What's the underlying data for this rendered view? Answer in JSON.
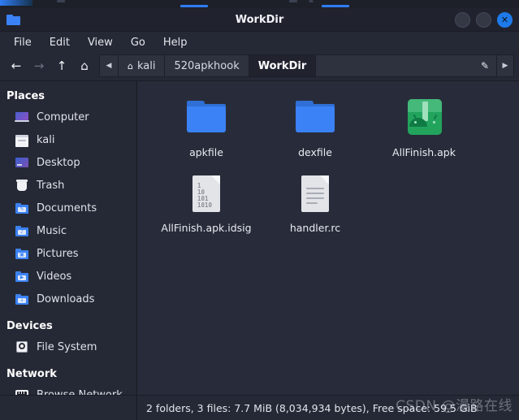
{
  "window": {
    "title": "WorkDir",
    "icon": "folder-icon",
    "buttons": {
      "minimize": "",
      "maximize": "",
      "close": "✕"
    }
  },
  "menubar": {
    "items": [
      {
        "label": "File"
      },
      {
        "label": "Edit"
      },
      {
        "label": "View"
      },
      {
        "label": "Go"
      },
      {
        "label": "Help"
      }
    ]
  },
  "toolbar": {
    "back": "←",
    "forward": "→",
    "up": "↑",
    "home": "⌂",
    "scroll_left": "◀",
    "scroll_right": "▶",
    "edit_path": "✎",
    "breadcrumbs": [
      {
        "label": "kali",
        "icon": "home-icon",
        "active": false
      },
      {
        "label": "520apkhook",
        "icon": "",
        "active": false
      },
      {
        "label": "WorkDir",
        "icon": "",
        "active": true
      }
    ]
  },
  "sidebar": {
    "sections": [
      {
        "title": "Places",
        "items": [
          {
            "label": "Computer",
            "icon": "computer-icon"
          },
          {
            "label": "kali",
            "icon": "home-folder-icon"
          },
          {
            "label": "Desktop",
            "icon": "desktop-icon"
          },
          {
            "label": "Trash",
            "icon": "trash-icon"
          },
          {
            "label": "Documents",
            "icon": "documents-folder-icon"
          },
          {
            "label": "Music",
            "icon": "music-folder-icon"
          },
          {
            "label": "Pictures",
            "icon": "pictures-folder-icon"
          },
          {
            "label": "Videos",
            "icon": "videos-folder-icon"
          },
          {
            "label": "Downloads",
            "icon": "downloads-folder-icon"
          }
        ]
      },
      {
        "title": "Devices",
        "items": [
          {
            "label": "File System",
            "icon": "disk-icon"
          }
        ]
      },
      {
        "title": "Network",
        "items": [
          {
            "label": "Browse Network",
            "icon": "network-icon"
          }
        ]
      }
    ]
  },
  "files": [
    {
      "name": "apkfile",
      "type": "folder"
    },
    {
      "name": "dexfile",
      "type": "folder"
    },
    {
      "name": "AllFinish.apk",
      "type": "apk"
    },
    {
      "name": "AllFinish.apk.idsig",
      "type": "binary"
    },
    {
      "name": "handler.rc",
      "type": "text"
    }
  ],
  "binary_icon_lines": [
    "1",
    "10",
    "101",
    "1010"
  ],
  "statusbar": {
    "text": "2 folders, 3 files: 7.7 MiB (8,034,934 bytes), Free space: 59.5 GiB"
  },
  "watermark": {
    "text": "CSDN @漫路在线"
  },
  "colors": {
    "folder_blue": "#3b82f6",
    "apk_green": "#22a45d",
    "close_button": "#1e7ae8",
    "window_bg": "#252935",
    "fileview_bg": "#282c3a"
  }
}
